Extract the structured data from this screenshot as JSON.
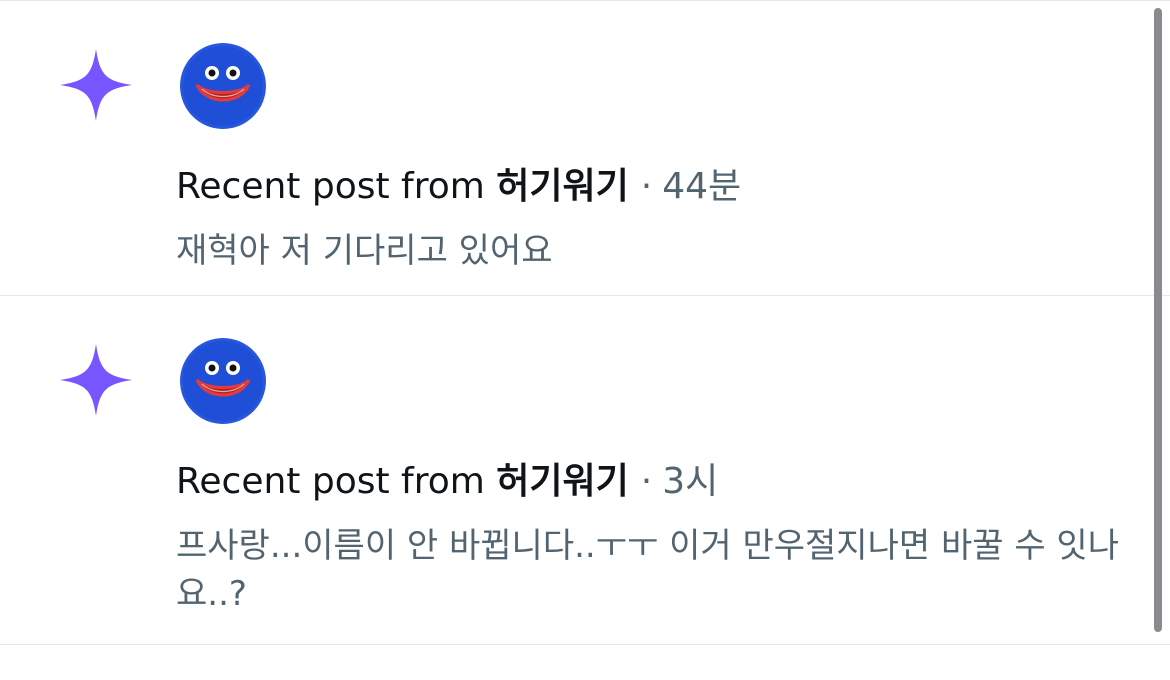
{
  "colors": {
    "sparkle": "#7856ff",
    "avatar": "#1f4fd6",
    "primary_text": "#0f1419",
    "secondary_text": "#536471",
    "divider": "#e3e6ea"
  },
  "notifications": [
    {
      "icon": "sparkle-icon",
      "avatar": "huggy-wuggy-avatar",
      "prefix": "Recent post from",
      "author": "허기워기",
      "separator": "·",
      "time": "44분",
      "snippet": "재혁아 저 기다리고 있어요"
    },
    {
      "icon": "sparkle-icon",
      "avatar": "huggy-wuggy-avatar",
      "prefix": "Recent post from",
      "author": "허기워기",
      "separator": "·",
      "time": "3시",
      "snippet": "프사랑...이름이 안 바뀝니다..ㅜㅜ 이거 만우절지나면 바꿀 수 잇나요..?"
    }
  ]
}
